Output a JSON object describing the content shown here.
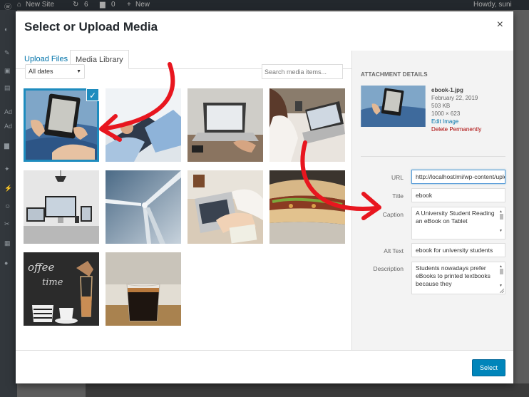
{
  "adminbar": {
    "site_name": "New Site",
    "updates_count": "6",
    "comments_count": "0",
    "new_label": "New",
    "greeting": "Howdy, suni"
  },
  "sidemenu": {
    "partial_labels": [
      "Ad",
      "Ad"
    ]
  },
  "modal": {
    "title": "Select or Upload Media",
    "close_label": "×",
    "tabs": [
      {
        "label": "Upload Files",
        "active": false
      },
      {
        "label": "Media Library",
        "active": true
      }
    ],
    "filter": {
      "selected": "All dates"
    },
    "search": {
      "placeholder": "Search media items..."
    },
    "media_items": [
      {
        "name": "ebook-tablet-reading",
        "selected": true
      },
      {
        "name": "person-using-tablet"
      },
      {
        "name": "laptop-on-desk"
      },
      {
        "name": "woman-with-laptop"
      },
      {
        "name": "workspace-devices"
      },
      {
        "name": "wind-turbine"
      },
      {
        "name": "typing-on-laptop"
      },
      {
        "name": "sandwich"
      },
      {
        "name": "coffee-time-board"
      },
      {
        "name": "espresso-glass"
      }
    ],
    "details": {
      "heading": "ATTACHMENT DETAILS",
      "filename": "ebook-1.jpg",
      "date": "February 22, 2019",
      "filesize": "503 KB",
      "dimensions": "1000 × 623",
      "edit_link": "Edit Image",
      "delete_link": "Delete Permanently",
      "fields": {
        "url": {
          "label": "URL",
          "value": "http://localhost/mi/wp-content/uploads"
        },
        "title": {
          "label": "Title",
          "value": "ebook"
        },
        "caption": {
          "label": "Caption",
          "value": "A University Student Reading an eBook on Tablet"
        },
        "alt": {
          "label": "Alt Text",
          "value": "ebook for university students"
        },
        "description": {
          "label": "Description",
          "value": "Students nowadays prefer eBooks to printed textbooks because they"
        }
      }
    },
    "footer": {
      "select_label": "Select"
    },
    "colors": {
      "accent": "#0085ba",
      "selected_outline": "#1e8cbe",
      "annotation": "#e8161f",
      "delete": "#a00000"
    }
  }
}
